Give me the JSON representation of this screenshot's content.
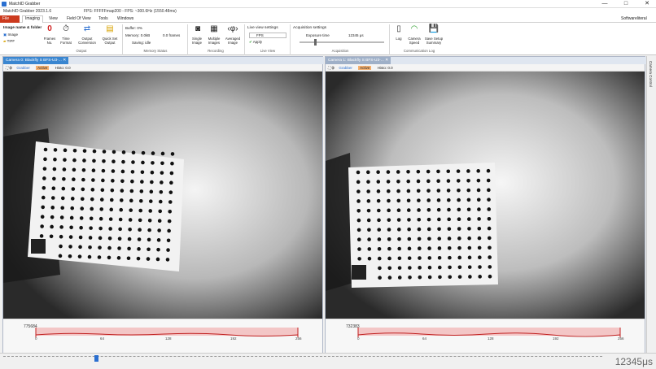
{
  "window": {
    "title": "MatchID Grabber",
    "minimize": "—",
    "maximize": "□",
    "close": "✕"
  },
  "status": {
    "version": "MatchID Grabber 2023.1.6",
    "fps": "FPS: FFFFFmap200 - FPS: ~300.6Hz (1550.48ms)"
  },
  "menu": {
    "file": "File",
    "items": [
      "Imaging",
      "View",
      "Field Of View",
      "Tools",
      "Windows"
    ],
    "right": "Softwareliteral"
  },
  "ribbon": {
    "image_name": "Image name & folder",
    "image": "Image",
    "tiff": "TIFF",
    "frames_no": "Frames No.",
    "time_format": "Time Format",
    "output_conversion": "Output Conversion",
    "quick_set_output": "Quick Set Output",
    "output_group": "Output",
    "buffer_info": "Buffer: 0%",
    "memory_info": "Memory: 0.0kB",
    "frames_info": "0.0 frames",
    "saving_info": "Saving: idle",
    "memory_group": "Memory Status",
    "single_image": "Single Image",
    "multiple_images": "Multiple Images",
    "averaged_image": "Averaged Image",
    "recording_group": "Recording",
    "live_view_settings": "Live view settings",
    "live_fps": "FPS",
    "apply": "Apply",
    "live_view_group": "Live View",
    "acq_settings": "Acquisition settings",
    "exposure": "Exposure time",
    "exposure_value": "12345 μs",
    "acquisition_group": "Acquisition",
    "log": "Log",
    "camera_speed": "Camera Speed",
    "save_setup": "Save Setup Summary",
    "comm_group": "Communication Log"
  },
  "panels": [
    {
      "tab": "Camera 0: Blackfly S BFS-U3-...",
      "toolbar": [
        "Grabber",
        "Active",
        "Histo: 0.0"
      ],
      "histo_count": "775684",
      "ticks": [
        "0",
        "64",
        "128",
        "192",
        "256"
      ]
    },
    {
      "tab": "Camera 1: Blackfly S BFS-U3-...",
      "toolbar": [
        "Grabber",
        "Active",
        "Histo: 0.0"
      ],
      "histo_count": "732383",
      "ticks": [
        "0",
        "64",
        "128",
        "192",
        "256"
      ]
    }
  ],
  "side_tab": "Camera Control",
  "timer": "12345μs",
  "colors": {
    "accent_tab": "#3a86d0",
    "file_menu": "#cc3a1e",
    "histogram_line": "#c02020",
    "histogram_band": "#f3c6c6"
  }
}
